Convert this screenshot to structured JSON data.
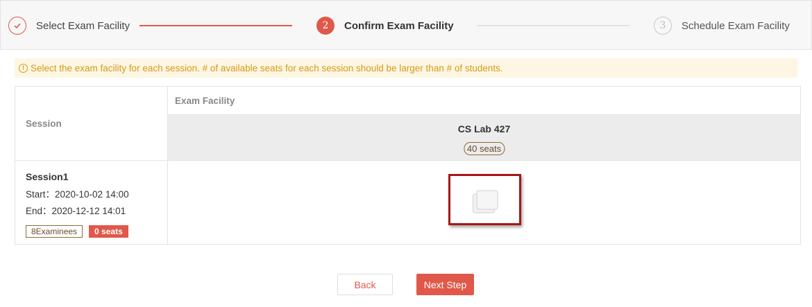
{
  "steps": [
    {
      "number": "",
      "label": "Select Exam Facility",
      "state": "done"
    },
    {
      "number": "2",
      "label": "Confirm Exam Facility",
      "state": "active"
    },
    {
      "number": "3",
      "label": "Schedule Exam Facility",
      "state": "todo"
    }
  ],
  "notice": {
    "icon": "!",
    "text": "Select the exam facility for each session. # of available seats for each session should be larger than # of students."
  },
  "table": {
    "session_header": "Session",
    "facility_header": "Exam Facility",
    "facility": {
      "name": "CS Lab 427",
      "seats": "40 seats"
    },
    "session": {
      "name": "Session1",
      "start": "Start：2020-10-02 14:00",
      "end": "End：2020-12-12 14:01",
      "examinees_tag": "8Examinees",
      "seats_tag": "0 seats"
    }
  },
  "buttons": {
    "back": "Back",
    "next": "Next Step"
  },
  "colors": {
    "accent": "#e0584a",
    "warning_text": "#d49a1a",
    "warning_bg": "#fdf6e3",
    "highlight": "#a81616"
  },
  "icons": {
    "step_done": "check-circle-icon",
    "notice": "warning-circle-icon",
    "seat_checkbox": "checkbox-icon"
  }
}
